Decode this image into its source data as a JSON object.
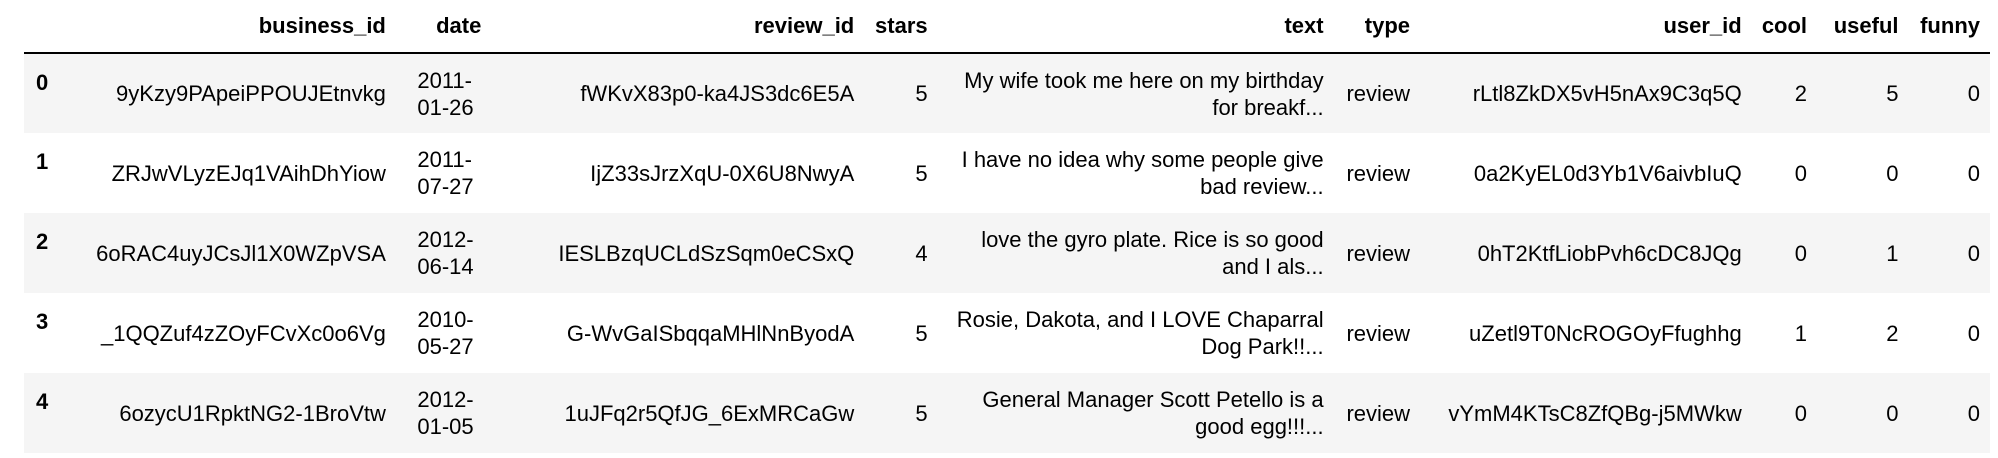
{
  "columns": {
    "index": "",
    "business_id": "business_id",
    "date": "date",
    "review_id": "review_id",
    "stars": "stars",
    "text": "text",
    "type": "type",
    "user_id": "user_id",
    "cool": "cool",
    "useful": "useful",
    "funny": "funny"
  },
  "rows": [
    {
      "index": "0",
      "business_id": "9yKzy9PApeiPPOUJEtnvkg",
      "date": "2011-01-26",
      "review_id": "fWKvX83p0-ka4JS3dc6E5A",
      "stars": "5",
      "text": "My wife took me here on my birthday for breakf...",
      "type": "review",
      "user_id": "rLtl8ZkDX5vH5nAx9C3q5Q",
      "cool": "2",
      "useful": "5",
      "funny": "0"
    },
    {
      "index": "1",
      "business_id": "ZRJwVLyzEJq1VAihDhYiow",
      "date": "2011-07-27",
      "review_id": "IjZ33sJrzXqU-0X6U8NwyA",
      "stars": "5",
      "text": "I have no idea why some people give bad review...",
      "type": "review",
      "user_id": "0a2KyEL0d3Yb1V6aivbIuQ",
      "cool": "0",
      "useful": "0",
      "funny": "0"
    },
    {
      "index": "2",
      "business_id": "6oRAC4uyJCsJl1X0WZpVSA",
      "date": "2012-06-14",
      "review_id": "IESLBzqUCLdSzSqm0eCSxQ",
      "stars": "4",
      "text": "love the gyro plate. Rice is so good and I als...",
      "type": "review",
      "user_id": "0hT2KtfLiobPvh6cDC8JQg",
      "cool": "0",
      "useful": "1",
      "funny": "0"
    },
    {
      "index": "3",
      "business_id": "_1QQZuf4zZOyFCvXc0o6Vg",
      "date": "2010-05-27",
      "review_id": "G-WvGaISbqqaMHlNnByodA",
      "stars": "5",
      "text": "Rosie, Dakota, and I LOVE Chaparral Dog Park!!...",
      "type": "review",
      "user_id": "uZetl9T0NcROGOyFfughhg",
      "cool": "1",
      "useful": "2",
      "funny": "0"
    },
    {
      "index": "4",
      "business_id": "6ozycU1RpktNG2-1BroVtw",
      "date": "2012-01-05",
      "review_id": "1uJFq2r5QfJG_6ExMRCaGw",
      "stars": "5",
      "text": "General Manager Scott Petello is a good egg!!!...",
      "type": "review",
      "user_id": "vYmM4KTsC8ZfQBg-j5MWkw",
      "cool": "0",
      "useful": "0",
      "funny": "0"
    }
  ]
}
